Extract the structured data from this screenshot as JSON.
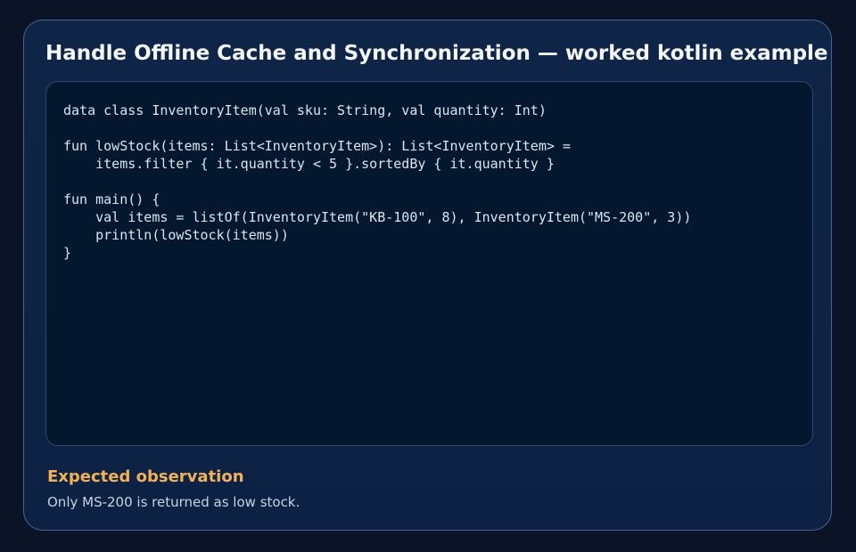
{
  "card": {
    "title": "Handle Offline Cache and Synchronization — worked kotlin example",
    "code": "data class InventoryItem(val sku: String, val quantity: Int)\n\nfun lowStock(items: List<InventoryItem>): List<InventoryItem> =\n    items.filter { it.quantity < 5 }.sortedBy { it.quantity }\n\nfun main() {\n    val items = listOf(InventoryItem(\"KB-100\", 8), InventoryItem(\"MS-200\", 3))\n    println(lowStock(items))\n}",
    "observation": {
      "heading": "Expected observation",
      "text": "Only MS-200 is returned as low stock."
    }
  },
  "colors": {
    "page_background": "#0a1426",
    "card_background": "#0f2547",
    "card_border": "#4a6490",
    "code_background": "#03182f",
    "title_text": "#f4f6fa",
    "code_text": "#dce4ef",
    "observation_heading": "#f2b257",
    "observation_text": "#c9d3e1"
  }
}
